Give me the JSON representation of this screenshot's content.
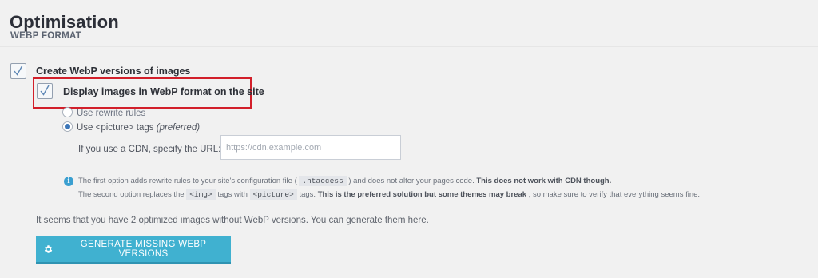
{
  "page": {
    "title": "Optimisation",
    "subtitle": "WEBP FORMAT"
  },
  "webp": {
    "create_label": "Create WebP versions of images",
    "create_checked": true,
    "display_label": "Display images in WebP format on the site",
    "display_checked": true,
    "method_options": [
      {
        "label": "Use rewrite rules",
        "selected": false
      },
      {
        "label": "Use <picture> tags",
        "suffix": "(preferred)",
        "selected": true
      }
    ],
    "cdn_label": "If you use a CDN, specify the URL:",
    "cdn_placeholder": "https://cdn.example.com",
    "cdn_value": ""
  },
  "info": {
    "icon": "info-icon",
    "line1": {
      "pre": "The first option adds rewrite rules to your site's configuration file (",
      "code": ".htaccess",
      "mid": ") and does not alter your pages code. ",
      "bold": "This does not work with CDN though."
    },
    "line2": {
      "pre": "The second option replaces the ",
      "code1": "<img>",
      "mid": " tags with ",
      "code2": "<picture>",
      "mid2": " tags. ",
      "bold": "This is the preferred solution but some themes may break",
      "post": ", so make sure to verify that everything seems fine."
    }
  },
  "generate": {
    "text": "It seems that you have 2 optimized images without WebP versions. You can generate them here.",
    "button_label": "GENERATE MISSING WEBP VERSIONS",
    "button_icon": "gear-icon"
  },
  "colors": {
    "button": "#40b1d0",
    "highlight": "#d21f2a",
    "radio_selected": "#3c76b8",
    "info": "#3a9fd0"
  }
}
